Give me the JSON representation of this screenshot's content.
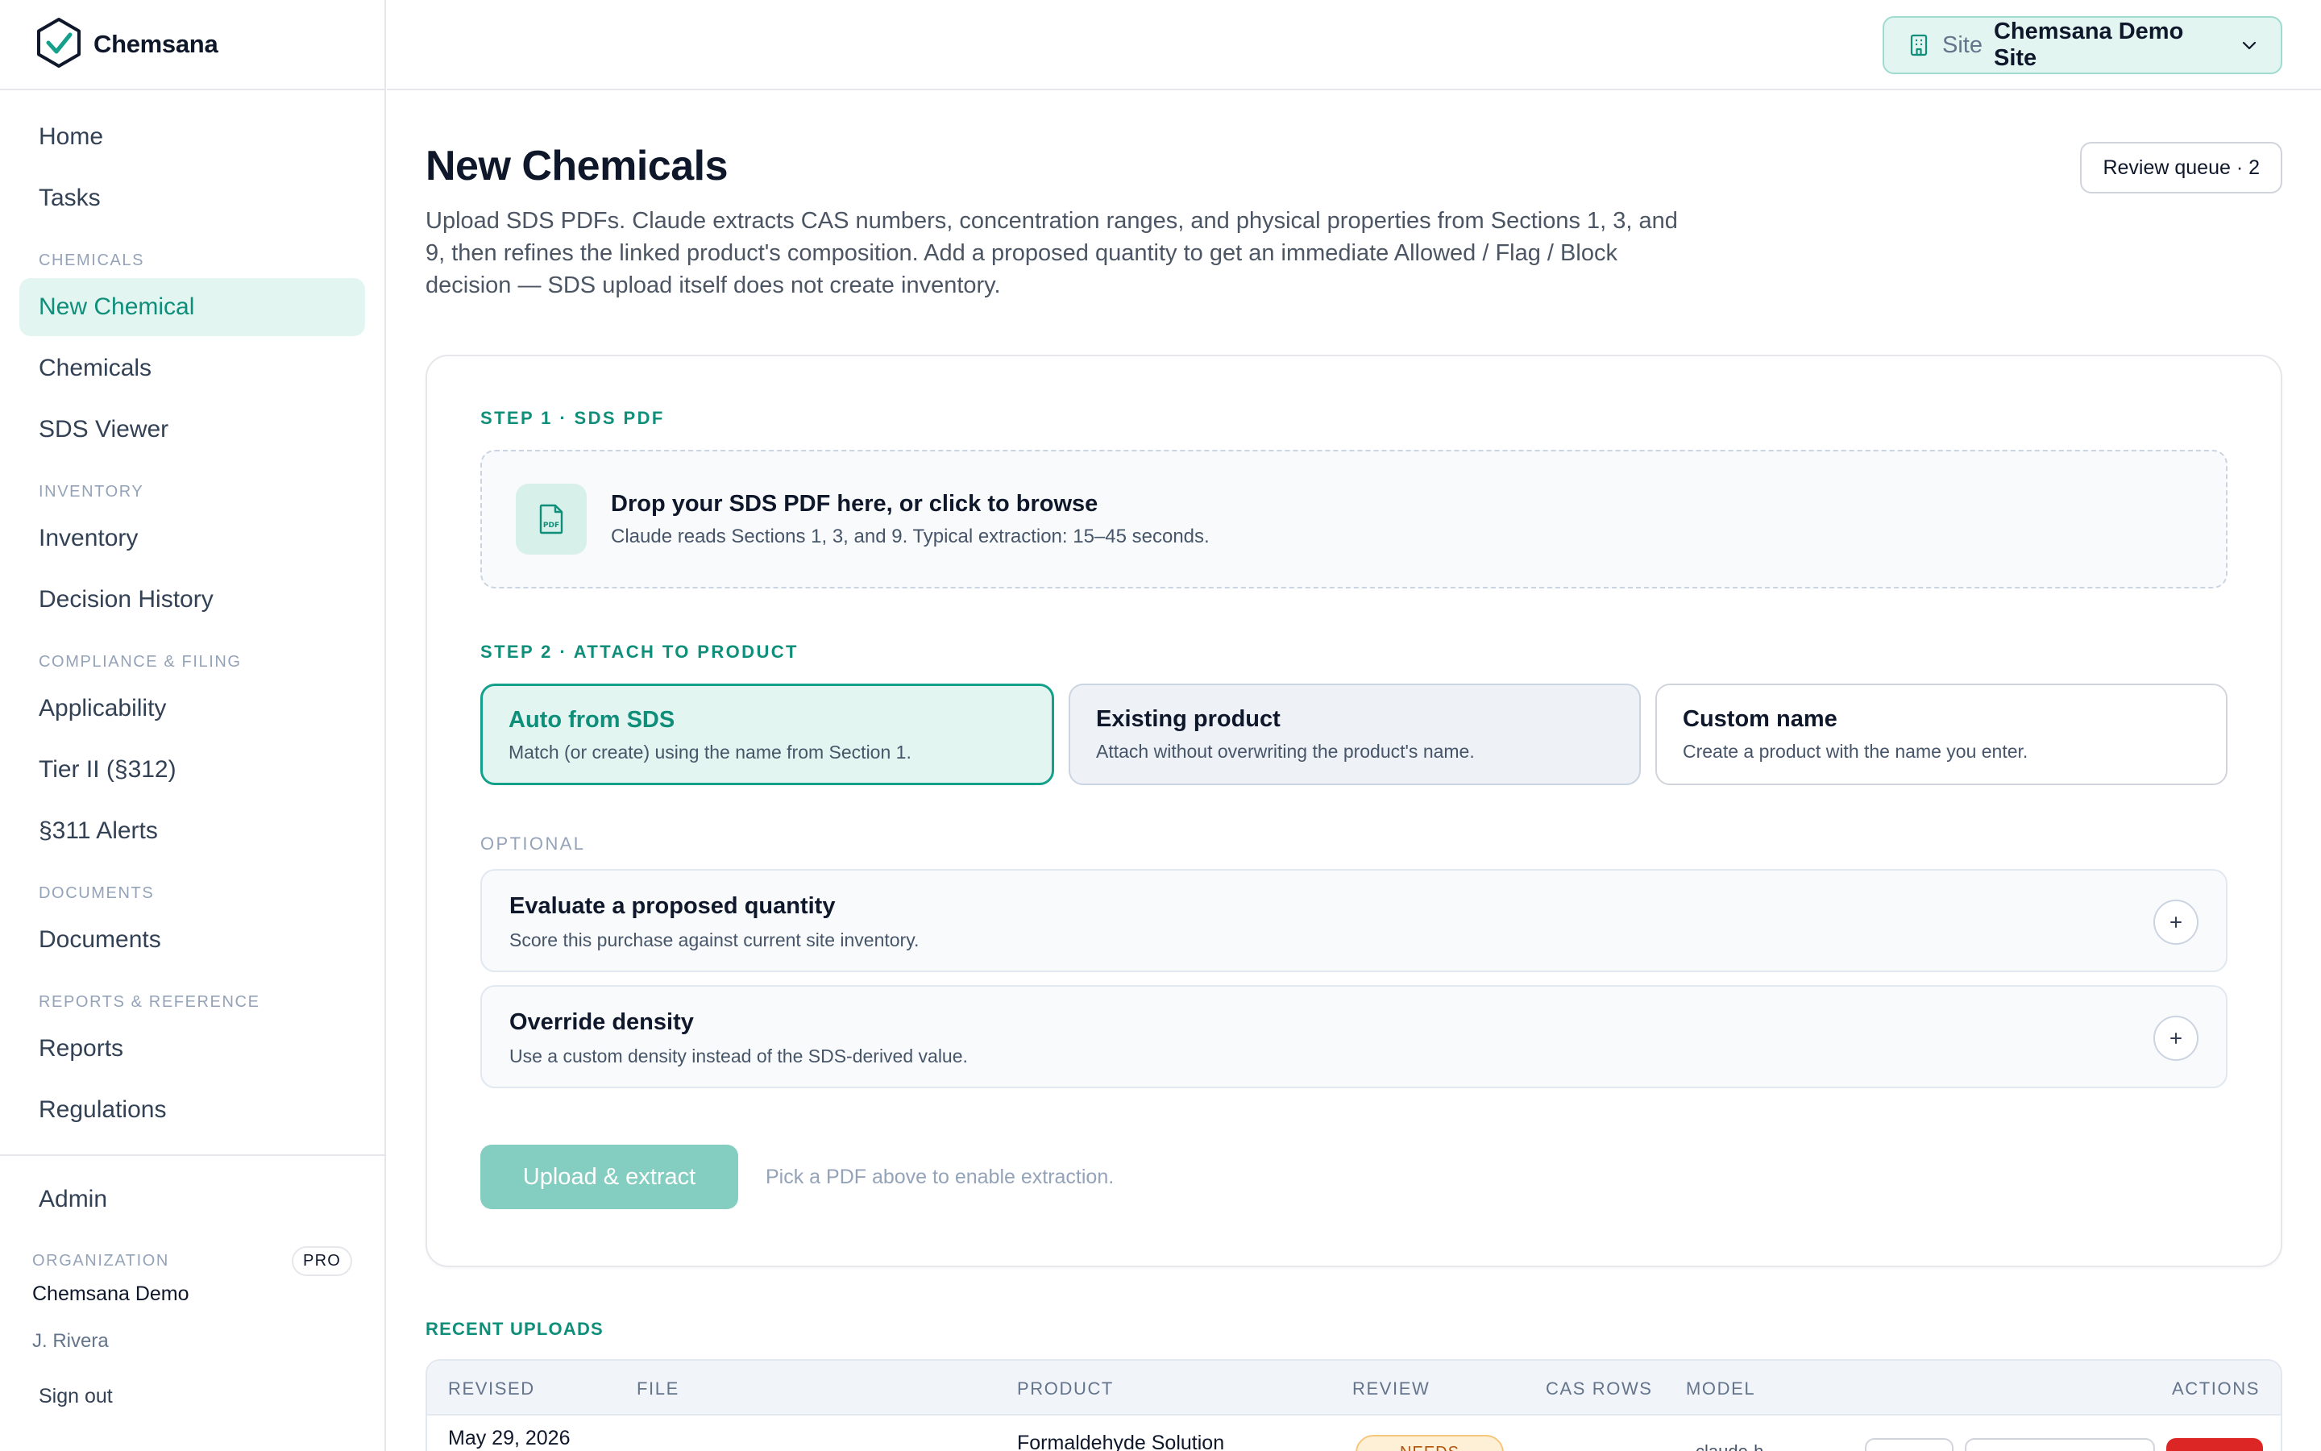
{
  "brand": {
    "name": "Chemsana",
    "accent": "#0f8f7a"
  },
  "topbar": {
    "site_label": "Site",
    "site_value": "Chemsana Demo Site"
  },
  "sidebar": {
    "items_top": [
      {
        "label": "Home"
      },
      {
        "label": "Tasks"
      }
    ],
    "sections": [
      {
        "title": "CHEMICALS",
        "items": [
          {
            "label": "New Chemical",
            "active": true
          },
          {
            "label": "Chemicals"
          },
          {
            "label": "SDS Viewer"
          }
        ]
      },
      {
        "title": "INVENTORY",
        "items": [
          {
            "label": "Inventory"
          },
          {
            "label": "Decision History"
          }
        ]
      },
      {
        "title": "COMPLIANCE & FILING",
        "items": [
          {
            "label": "Applicability"
          },
          {
            "label": "Tier II (§312)"
          },
          {
            "label": "§311 Alerts"
          }
        ]
      },
      {
        "title": "DOCUMENTS",
        "items": [
          {
            "label": "Documents"
          }
        ]
      },
      {
        "title": "REPORTS & REFERENCE",
        "items": [
          {
            "label": "Reports"
          },
          {
            "label": "Regulations"
          }
        ]
      }
    ],
    "admin_label": "Admin",
    "org_label": "ORGANIZATION",
    "plan_badge": "PRO",
    "org_name": "Chemsana Demo",
    "user_name": "J. Rivera",
    "signout_label": "Sign out"
  },
  "main": {
    "title": "New Chemicals",
    "review_queue": "Review queue · 2",
    "intro": "Upload SDS PDFs. Claude extracts CAS numbers, concentration ranges, and physical properties from Sections 1, 3, and 9, then refines the linked product's composition. Add a proposed quantity to get an immediate Allowed / Flag / Block decision — SDS upload itself does not create inventory."
  },
  "step1": {
    "label": "STEP 1 · SDS PDF",
    "drop_title": "Drop your SDS PDF here, or click to browse",
    "drop_sub": "Claude reads Sections 1, 3, and 9. Typical extraction: 15–45 seconds."
  },
  "step2": {
    "label": "STEP 2 · ATTACH TO PRODUCT",
    "options": [
      {
        "title": "Auto from SDS",
        "sub": "Match (or create) using the name from Section 1."
      },
      {
        "title": "Existing product",
        "sub": "Attach without overwriting the product's name."
      },
      {
        "title": "Custom name",
        "sub": "Create a product with the name you enter."
      }
    ]
  },
  "optional": {
    "label": "OPTIONAL",
    "items": [
      {
        "title": "Evaluate a proposed quantity",
        "sub": "Score this purchase against current site inventory."
      },
      {
        "title": "Override density",
        "sub": "Use a custom density instead of the SDS-derived value."
      }
    ]
  },
  "actions": {
    "upload_label": "Upload & extract",
    "hint": "Pick a PDF above to enable extraction."
  },
  "recent": {
    "label": "RECENT UPLOADS",
    "columns": [
      "REVISED",
      "FILE",
      "PRODUCT",
      "REVIEW",
      "CAS ROWS",
      "MODEL",
      "ACTIONS"
    ],
    "rows": [
      {
        "revised": "May 29, 2026",
        "product": "Formaldehyde Solution",
        "review": "NEEDS",
        "model": "claude-h"
      }
    ]
  }
}
